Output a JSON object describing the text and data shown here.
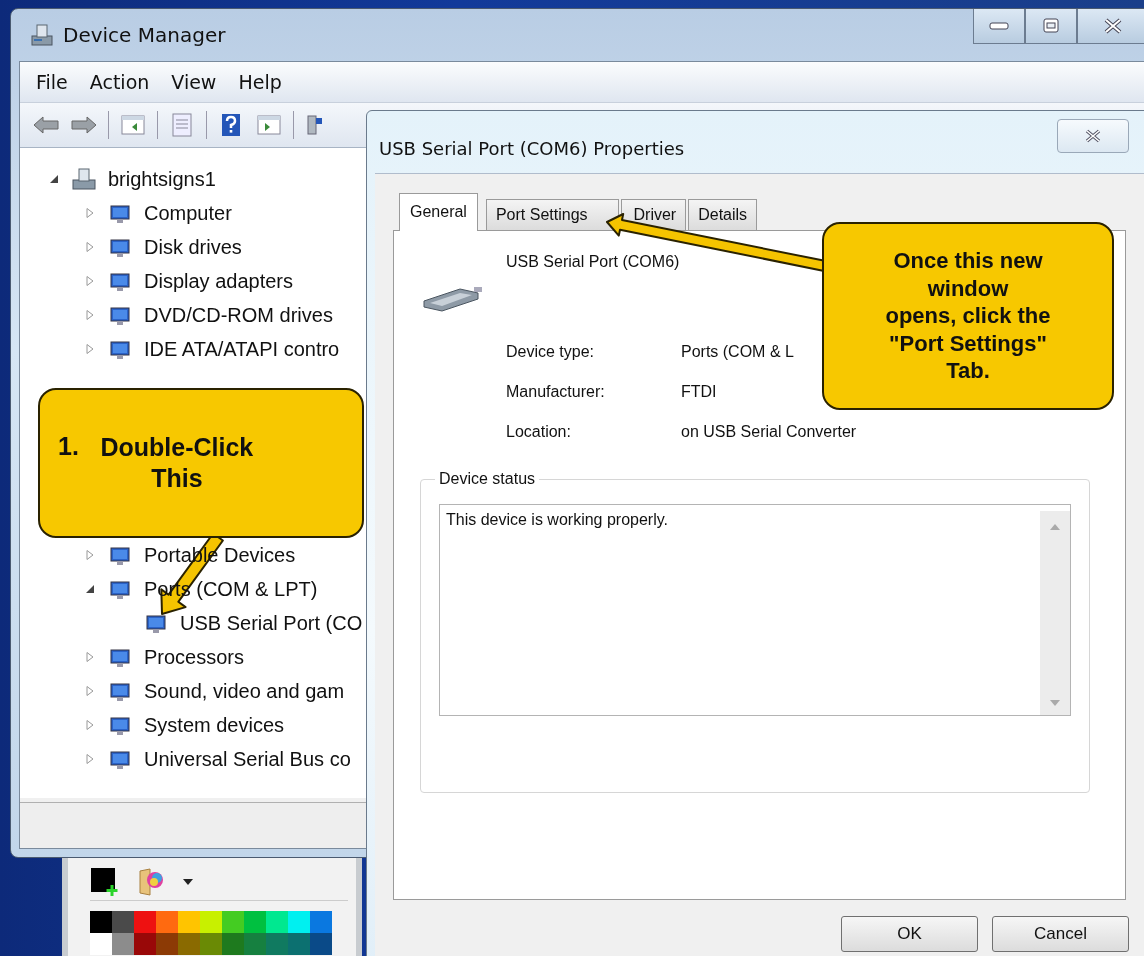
{
  "main_window": {
    "title": "Device Manager",
    "menu": [
      "File",
      "Action",
      "View",
      "Help"
    ],
    "tree": [
      {
        "label": "brightsigns1",
        "expanded": true,
        "children": [
          {
            "label": "Computer",
            "expanded": false
          },
          {
            "label": "Disk drives",
            "expanded": false
          },
          {
            "label": "Display adapters",
            "expanded": false
          },
          {
            "label": "DVD/CD-ROM drives",
            "expanded": false
          },
          {
            "label": "IDE ATA/ATAPI contro",
            "expanded": false
          },
          {
            "label": "Portable Devices",
            "expanded": false
          },
          {
            "label": "Ports (COM & LPT)",
            "expanded": true,
            "children": [
              {
                "label": "USB Serial Port (CO"
              }
            ]
          },
          {
            "label": "Processors",
            "expanded": false
          },
          {
            "label": "Sound, video and gam",
            "expanded": false
          },
          {
            "label": "System devices",
            "expanded": false
          },
          {
            "label": "Universal Serial Bus co",
            "expanded": false
          }
        ]
      }
    ]
  },
  "dialog": {
    "title": "USB Serial Port (COM6) Properties",
    "tabs": [
      {
        "label": "General",
        "selected": true
      },
      {
        "label": "Port Settings",
        "selected": false
      },
      {
        "label": "Driver",
        "selected": false
      },
      {
        "label": "Details",
        "selected": false
      }
    ],
    "device_name": "USB Serial Port (COM6)",
    "properties": [
      {
        "label": "Device type:",
        "value": "Ports (COM & L"
      },
      {
        "label": "Manufacturer:",
        "value": "FTDI"
      },
      {
        "label": "Location:",
        "value": "on USB Serial Converter"
      }
    ],
    "status": {
      "legend": "Device status",
      "text": "This device is working properly."
    },
    "buttons": [
      "OK",
      "Cancel"
    ]
  },
  "callouts": [
    {
      "number": "1.",
      "text": "Double-Click\nThis"
    },
    {
      "text": "Once this new\nwindow\nopens, click the\n\"Port Settings\"\nTab."
    }
  ],
  "palette": {
    "swatches": [
      {
        "color": "#000000"
      },
      {
        "color": "#4a4a4a"
      },
      {
        "color": "#ee1111"
      },
      {
        "color": "#ff6a10"
      },
      {
        "color": "#ffc400"
      },
      {
        "color": "#c8f000"
      },
      {
        "color": "#44cc22"
      },
      {
        "color": "#00c040"
      },
      {
        "color": "#00e890"
      },
      {
        "color": "#00f0f0"
      },
      {
        "color": "#0a78e0"
      },
      {
        "color": "#ffffff"
      },
      {
        "color": "#8c8c8c"
      },
      {
        "color": "#990808"
      },
      {
        "color": "#8c3a05"
      },
      {
        "color": "#8a6a00"
      },
      {
        "color": "#6a8a05"
      },
      {
        "color": "#1e7a1e"
      },
      {
        "color": "#168040"
      },
      {
        "color": "#107a60"
      },
      {
        "color": "#0c7070"
      },
      {
        "color": "#0a4a88"
      }
    ]
  }
}
